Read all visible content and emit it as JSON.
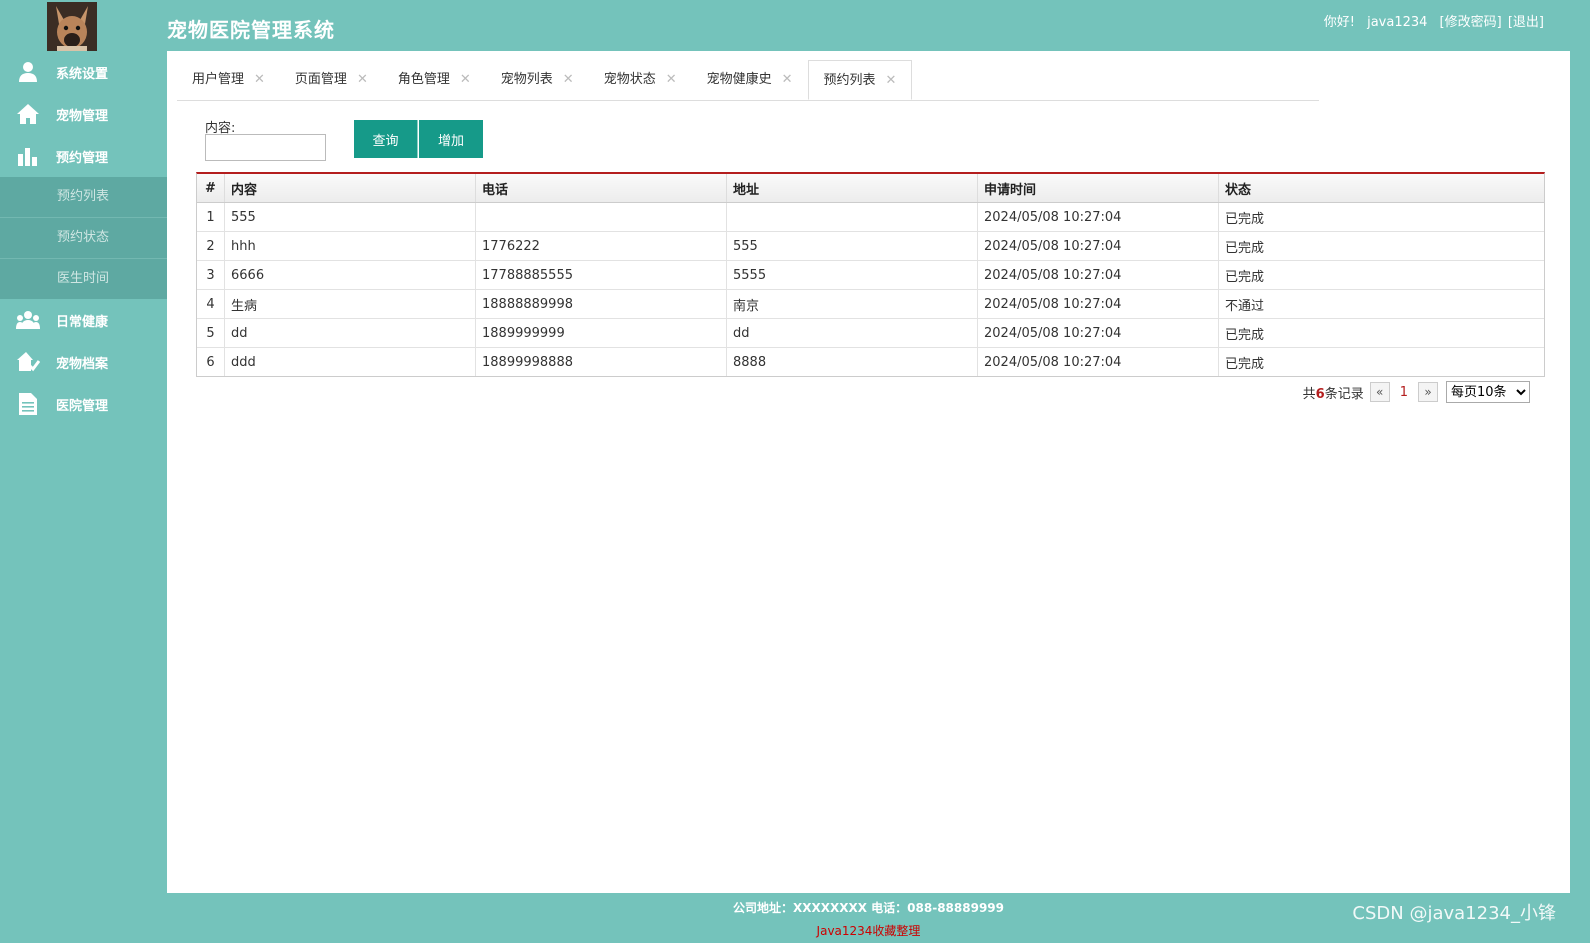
{
  "header": {
    "app_title": "宠物医院管理系统",
    "greeting": "你好!",
    "username": "java1234",
    "change_password": "[修改密码]",
    "logout": "[退出]"
  },
  "sidebar": {
    "items": [
      {
        "label": "系统设置",
        "icon": "user-icon"
      },
      {
        "label": "宠物管理",
        "icon": "home-icon"
      },
      {
        "label": "预约管理",
        "icon": "bar-chart-icon"
      },
      {
        "label": "日常健康",
        "icon": "group-icon"
      },
      {
        "label": "宠物档案",
        "icon": "archive-icon"
      },
      {
        "label": "医院管理",
        "icon": "document-icon"
      }
    ],
    "sub_items": [
      "预约列表",
      "预约状态",
      "医生时间"
    ]
  },
  "tabs": [
    {
      "label": "用户管理"
    },
    {
      "label": "页面管理"
    },
    {
      "label": "角色管理"
    },
    {
      "label": "宠物列表"
    },
    {
      "label": "宠物状态"
    },
    {
      "label": "宠物健康史"
    },
    {
      "label": "预约列表",
      "active": true
    }
  ],
  "search": {
    "label": "内容:",
    "value": "",
    "query_button": "查询",
    "add_button": "增加"
  },
  "table": {
    "columns": [
      "#",
      "内容",
      "电话",
      "地址",
      "申请时间",
      "状态"
    ],
    "rows": [
      [
        "1",
        "555",
        "",
        "",
        "2024/05/08 10:27:04",
        "已完成"
      ],
      [
        "2",
        "hhh",
        "1776222",
        "555",
        "2024/05/08 10:27:04",
        "已完成"
      ],
      [
        "3",
        "6666",
        "17788885555",
        "5555",
        "2024/05/08 10:27:04",
        "已完成"
      ],
      [
        "4",
        "生病",
        "18888889998",
        "南京",
        "2024/05/08 10:27:04",
        "不通过"
      ],
      [
        "5",
        "dd",
        "1889999999",
        "dd",
        "2024/05/08 10:27:04",
        "已完成"
      ],
      [
        "6",
        "ddd",
        "18899998888",
        "8888",
        "2024/05/08 10:27:04",
        "已完成"
      ]
    ]
  },
  "pager": {
    "prefix": "共",
    "count": "6",
    "suffix": "条记录",
    "prev": "«",
    "page": "1",
    "next": "»",
    "page_size": "每页10条"
  },
  "footer": {
    "address": "公司地址：XXXXXXXX 电话：088-88889999",
    "credit": "Java1234收藏整理"
  },
  "watermark": "CSDN @java1234_小锋",
  "colors": {
    "theme": "#74c3bb",
    "button": "#169a89",
    "accent_red": "#b41e1e"
  }
}
